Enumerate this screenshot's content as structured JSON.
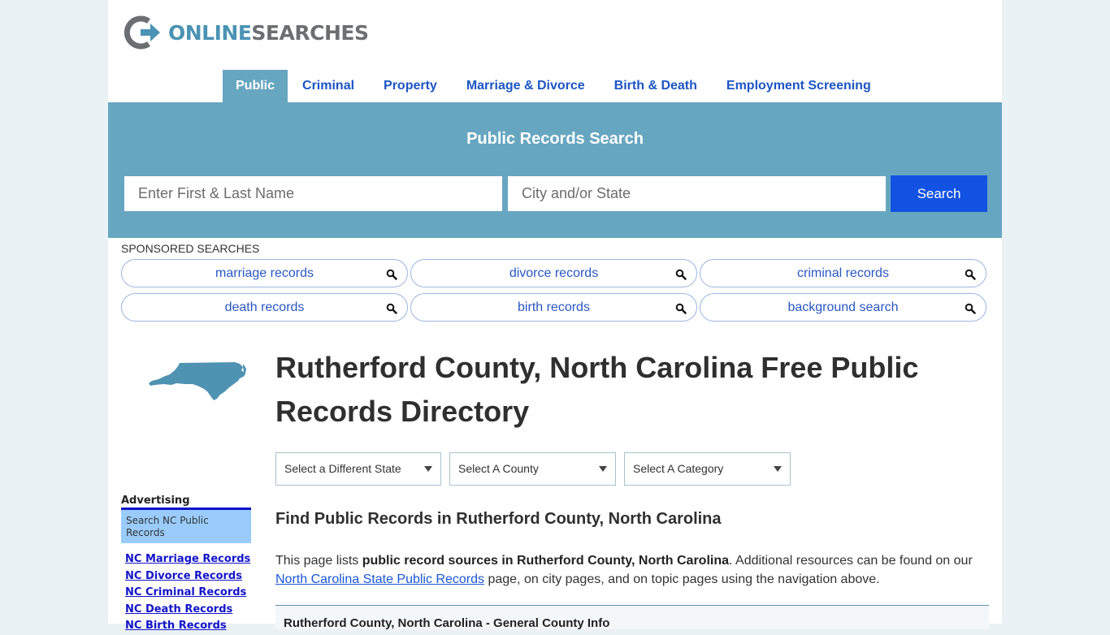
{
  "brand": {
    "logo_icon": "power-arrow-logo-icon",
    "name_part1": "ONLINE",
    "name_part2": "SEARCHES",
    "colors": {
      "blue": "#4b93b4",
      "gray": "#6d6e70"
    }
  },
  "nav": {
    "items": [
      {
        "label": "Public",
        "active": true
      },
      {
        "label": "Criminal",
        "active": false
      },
      {
        "label": "Property",
        "active": false
      },
      {
        "label": "Marriage & Divorce",
        "active": false
      },
      {
        "label": "Birth & Death",
        "active": false
      },
      {
        "label": "Employment Screening",
        "active": false
      }
    ]
  },
  "hero": {
    "title": "Public Records Search",
    "name_placeholder": "Enter First & Last Name",
    "name_value": "",
    "city_placeholder": "City and/or State",
    "city_value": "",
    "search_label": "Search",
    "colors": {
      "band": "#67a6c1",
      "button": "#1152e3"
    }
  },
  "sponsored": {
    "label": "SPONSORED SEARCHES",
    "items": [
      {
        "label": "marriage records",
        "icon": "search-icon"
      },
      {
        "label": "divorce records",
        "icon": "search-icon"
      },
      {
        "label": "criminal records",
        "icon": "search-icon"
      },
      {
        "label": "death records",
        "icon": "search-icon"
      },
      {
        "label": "birth records",
        "icon": "search-icon"
      },
      {
        "label": "background search",
        "icon": "search-icon"
      }
    ]
  },
  "main": {
    "state_image": "north-carolina-map",
    "title": "Rutherford County, North Carolina Free Public Records Directory",
    "selects": {
      "state": "Select a Different State",
      "county": "Select A County",
      "category": "Select A Category"
    },
    "subheading": "Find Public Records in Rutherford County, North Carolina",
    "intro": {
      "pre": "This page lists ",
      "bold": "public record sources in Rutherford County, North Carolina",
      "mid": ". Additional resources can be found on our ",
      "link": "North Carolina State Public Records",
      "post": " page, on city pages, and on topic pages using the navigation above."
    },
    "info_box_title": "Rutherford County, North Carolina - General County Info"
  },
  "sidebar": {
    "ad_label": "Advertising",
    "ad_box": "Search NC Public Records",
    "links": [
      "NC Marriage Records",
      "NC Divorce Records",
      "NC Criminal Records",
      "NC Death Records",
      "NC Birth Records"
    ]
  }
}
